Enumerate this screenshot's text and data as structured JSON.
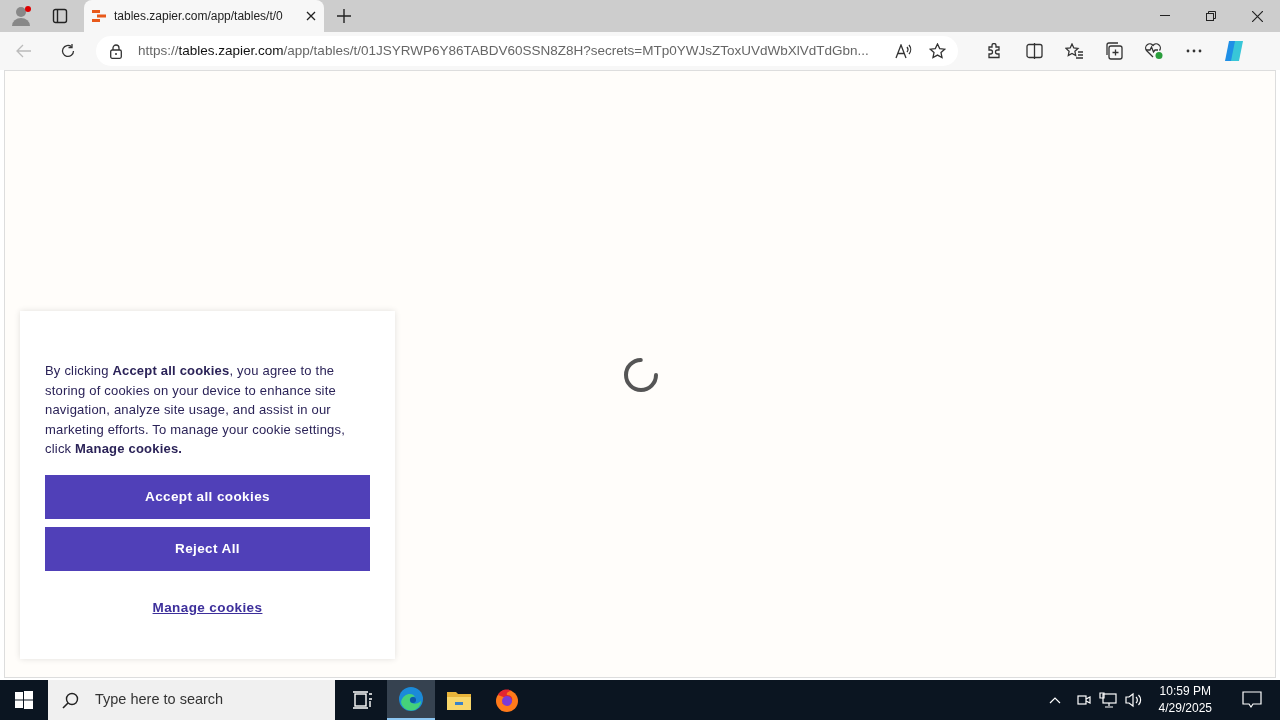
{
  "browser": {
    "tabs": [
      {
        "title": "tables.zapier.com/app/tables/t/0",
        "selected": true
      }
    ],
    "url": {
      "scheme": "https://",
      "host": "tables.zapier.com",
      "rest": "/app/tables/t/01JSYRWP6Y86TABDV60SSN8Z8H?secrets=MTp0YWJsZToxUVdWbXlVdTdGbn..."
    }
  },
  "page": {
    "loading": true
  },
  "cookie_banner": {
    "text": "By clicking **Accept all cookies**, you agree to the storing of cookies on your device to enhance site navigation, analyze site usage, and assist in our marketing efforts. To manage your cookie settings, click **Manage cookies.**",
    "buttons": [
      {
        "label": "Accept all cookies",
        "kind": "primary"
      },
      {
        "label": "Reject All",
        "kind": "primary"
      },
      {
        "label": "Manage cookies",
        "kind": "link"
      }
    ]
  },
  "taskbar": {
    "search_placeholder": "Type here to search",
    "apps": [
      {
        "kind": "edge",
        "selected": true
      },
      {
        "kind": "explorer",
        "selected": false
      },
      {
        "kind": "firefox",
        "selected": false
      }
    ],
    "time": "10:59 PM",
    "date": "4/29/2025"
  }
}
